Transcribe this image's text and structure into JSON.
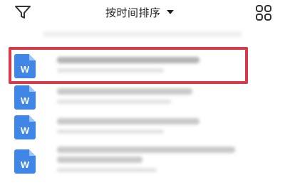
{
  "header": {
    "filter_icon": "filter-icon",
    "sort_label": "按时间排序",
    "sort_caret_icon": "caret-down-icon",
    "grid_icon": "grid-view-icon"
  },
  "files": [
    {
      "icon": "word-doc-icon",
      "icon_letter": "W",
      "highlighted": true
    },
    {
      "icon": "word-doc-icon",
      "icon_letter": "W",
      "highlighted": false
    },
    {
      "icon": "word-doc-icon",
      "icon_letter": "W",
      "highlighted": false
    },
    {
      "icon": "word-doc-icon",
      "icon_letter": "W",
      "highlighted": false
    }
  ],
  "colors": {
    "highlight_border": "#d93a4a",
    "doc_icon_blue": "#3f86e6"
  }
}
